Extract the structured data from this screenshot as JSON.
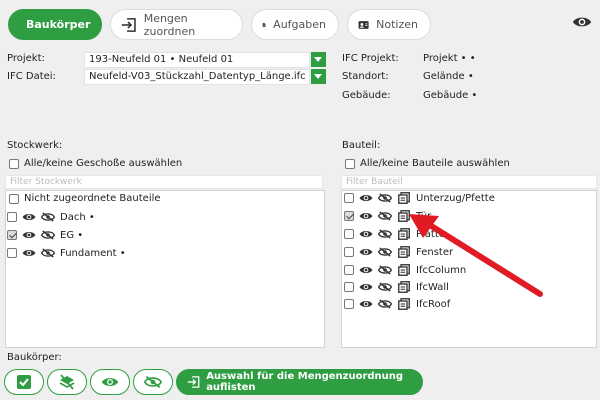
{
  "toolbar": {
    "tabs": [
      {
        "label": "Baukörper",
        "active": true,
        "icon": "search-box-icon"
      },
      {
        "label": "Mengen zuordnen",
        "active": false,
        "icon": "arrow-into-box-icon"
      },
      {
        "label": "Aufgaben",
        "active": false,
        "icon": "document-icon"
      },
      {
        "label": "Notizen",
        "active": false,
        "icon": "contact-card-icon"
      }
    ],
    "visibility_icon": "eye-icon"
  },
  "info": {
    "projekt_label": "Projekt:",
    "projekt_value": "193-Neufeld 01 • Neufeld 01",
    "ifc_datei_label": "IFC Datei:",
    "ifc_datei_value": "Neufeld-V03_Stückzahl_Datentyp_Länge.ifc •",
    "ifc_projekt_label": "IFC Projekt:",
    "ifc_projekt_value": "Projekt • •",
    "standort_label": "Standort:",
    "standort_value": "Gelände •",
    "gebaeude_label": "Gebäude:",
    "gebaeude_value": "Gebäude •"
  },
  "stockwerk": {
    "title": "Stockwerk:",
    "select_all": "Alle/keine Geschoße auswählen",
    "filter_placeholder": "Filter Stockwerk",
    "unassigned": "Nicht zugeordnete Bauteile",
    "items": [
      {
        "label": "Dach •",
        "checked": false
      },
      {
        "label": "EG •",
        "checked": true
      },
      {
        "label": "Fundament •",
        "checked": false
      }
    ]
  },
  "bauteil": {
    "title": "Bauteil:",
    "select_all": "Alle/keine Bauteile auswählen",
    "filter_placeholder": "Filter Bauteil",
    "items": [
      {
        "label": "Unterzug/Pfette",
        "checked": false
      },
      {
        "label": "Tür",
        "checked": true
      },
      {
        "label": "Platte",
        "checked": false
      },
      {
        "label": "Fenster",
        "checked": false
      },
      {
        "label": "IfcColumn",
        "checked": false
      },
      {
        "label": "IfcWall",
        "checked": false
      },
      {
        "label": "IfcRoof",
        "checked": false
      }
    ]
  },
  "bottom": {
    "label": "Baukörper:",
    "buttons": [
      "check-icon",
      "layers-off-icon",
      "eye-icon",
      "eye-off-icon"
    ],
    "list_button": "Auswahl für die Mengenzuordnung auflisten"
  },
  "colors": {
    "accent": "#2f9e43",
    "annotation_arrow": "#e01b24"
  }
}
